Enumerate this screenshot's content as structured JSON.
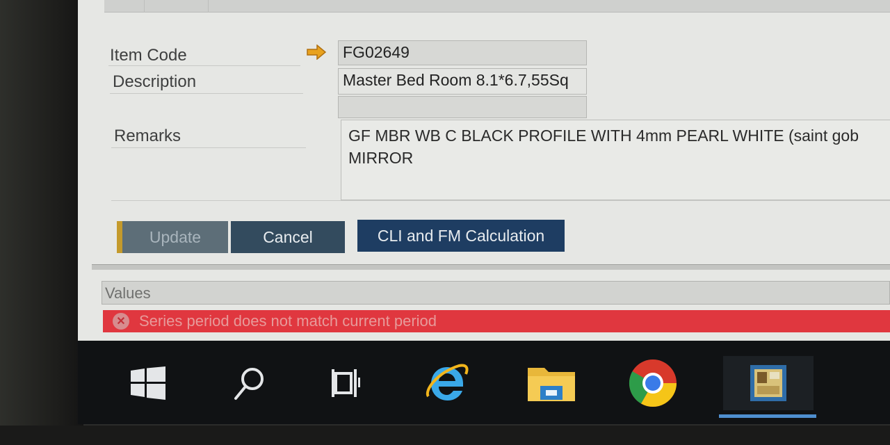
{
  "form": {
    "item_code_label": "Item Code",
    "item_code_value": "FG02649",
    "description_label": "Description",
    "description_value": "Master Bed Room 8.1*6.7,55Sq",
    "remarks_label": "Remarks",
    "remarks_lines": [
      "GF MBR WB C BLACK PROFILE WITH 4mm PEARL WHITE (saint gob",
      "MIRROR"
    ]
  },
  "buttons": {
    "update": "Update",
    "cancel": "Cancel",
    "cli_fm": "CLI and FM Calculation"
  },
  "values_bar": {
    "label": "Values"
  },
  "status": {
    "error_message": "Series period does not match current period",
    "error_color": "#e0373f"
  },
  "taskbar": {
    "icons": [
      "windows-start-icon",
      "search-icon",
      "task-view-icon",
      "internet-explorer-icon",
      "file-explorer-icon",
      "chrome-icon",
      "erp-app-icon"
    ],
    "accent": "#4f8fcf"
  }
}
